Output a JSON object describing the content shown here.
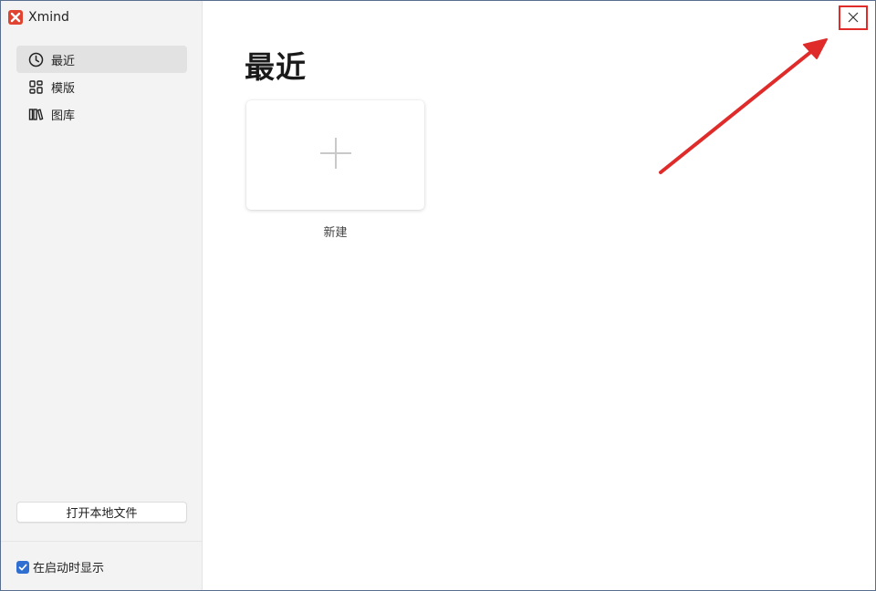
{
  "app": {
    "name": "Xmind"
  },
  "sidebar": {
    "items": [
      {
        "label": "最近",
        "icon": "clock-icon",
        "active": true
      },
      {
        "label": "模版",
        "icon": "template-grid-icon",
        "active": false
      },
      {
        "label": "图库",
        "icon": "library-books-icon",
        "active": false
      }
    ],
    "open_local_label": "打开本地文件",
    "show_on_startup_label": "在启动时显示",
    "show_on_startup_checked": true
  },
  "main": {
    "title": "最近",
    "new_card_label": "新建"
  },
  "colors": {
    "accent": "#2f6fd1",
    "annotation": "#e02b2b",
    "logo": "#e0432f"
  }
}
